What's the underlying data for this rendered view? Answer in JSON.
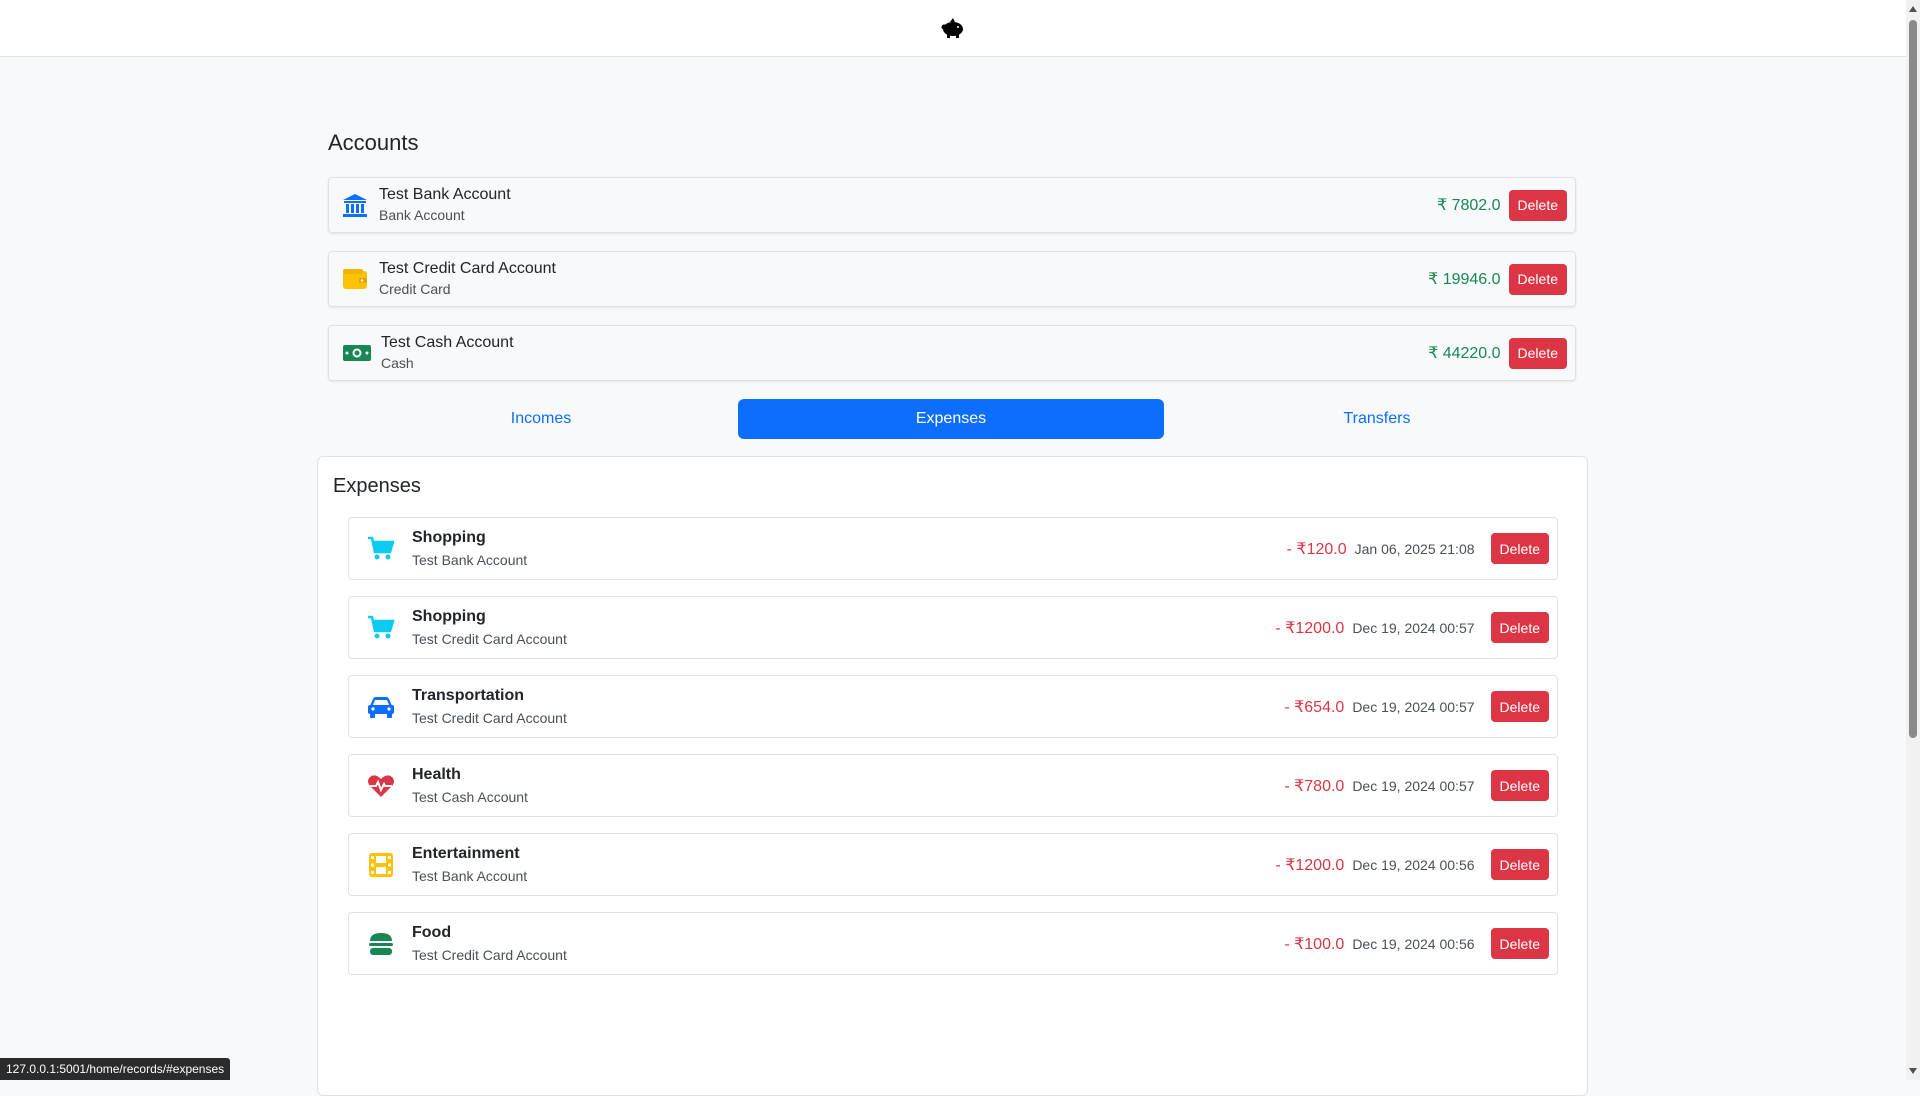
{
  "header": {
    "logo_icon": "piggy-bank-icon"
  },
  "accounts": {
    "title": "Accounts",
    "items": [
      {
        "name": "Test Bank Account",
        "type": "Bank Account",
        "amount": "₹ 7802.0",
        "icon": "bank-icon",
        "delete_label": "Delete"
      },
      {
        "name": "Test Credit Card Account",
        "type": "Credit Card",
        "amount": "₹ 19946.0",
        "icon": "wallet-icon",
        "delete_label": "Delete"
      },
      {
        "name": "Test Cash Account",
        "type": "Cash",
        "amount": "₹ 44220.0",
        "icon": "cash-icon",
        "delete_label": "Delete"
      }
    ]
  },
  "tabs": [
    {
      "label": "Incomes",
      "active": false
    },
    {
      "label": "Expenses",
      "active": true
    },
    {
      "label": "Transfers",
      "active": false
    }
  ],
  "expenses": {
    "title": "Expenses",
    "items": [
      {
        "category": "Shopping",
        "account": "Test Bank Account",
        "amount": "- ₹120.0",
        "date": "Jan 06, 2025 21:08",
        "icon": "cart-icon",
        "delete_label": "Delete"
      },
      {
        "category": "Shopping",
        "account": "Test Credit Card Account",
        "amount": "- ₹1200.0",
        "date": "Dec 19, 2024 00:57",
        "icon": "cart-icon",
        "delete_label": "Delete"
      },
      {
        "category": "Transportation",
        "account": "Test Credit Card Account",
        "amount": "- ₹654.0",
        "date": "Dec 19, 2024 00:57",
        "icon": "car-icon",
        "delete_label": "Delete"
      },
      {
        "category": "Health",
        "account": "Test Cash Account",
        "amount": "- ₹780.0",
        "date": "Dec 19, 2024 00:57",
        "icon": "heart-pulse-icon",
        "delete_label": "Delete"
      },
      {
        "category": "Entertainment",
        "account": "Test Bank Account",
        "amount": "- ₹1200.0",
        "date": "Dec 19, 2024 00:56",
        "icon": "film-icon",
        "delete_label": "Delete"
      },
      {
        "category": "Food",
        "account": "Test Credit Card Account",
        "amount": "- ₹100.0",
        "date": "Dec 19, 2024 00:56",
        "icon": "burger-icon",
        "delete_label": "Delete"
      }
    ]
  },
  "status_bar": {
    "url": "127.0.0.1:5001/home/records/#expenses"
  },
  "colors": {
    "primary": "#0d6efd",
    "danger": "#dc3545",
    "success": "#198754",
    "warning": "#ffc107",
    "info": "#0dcaf0"
  }
}
